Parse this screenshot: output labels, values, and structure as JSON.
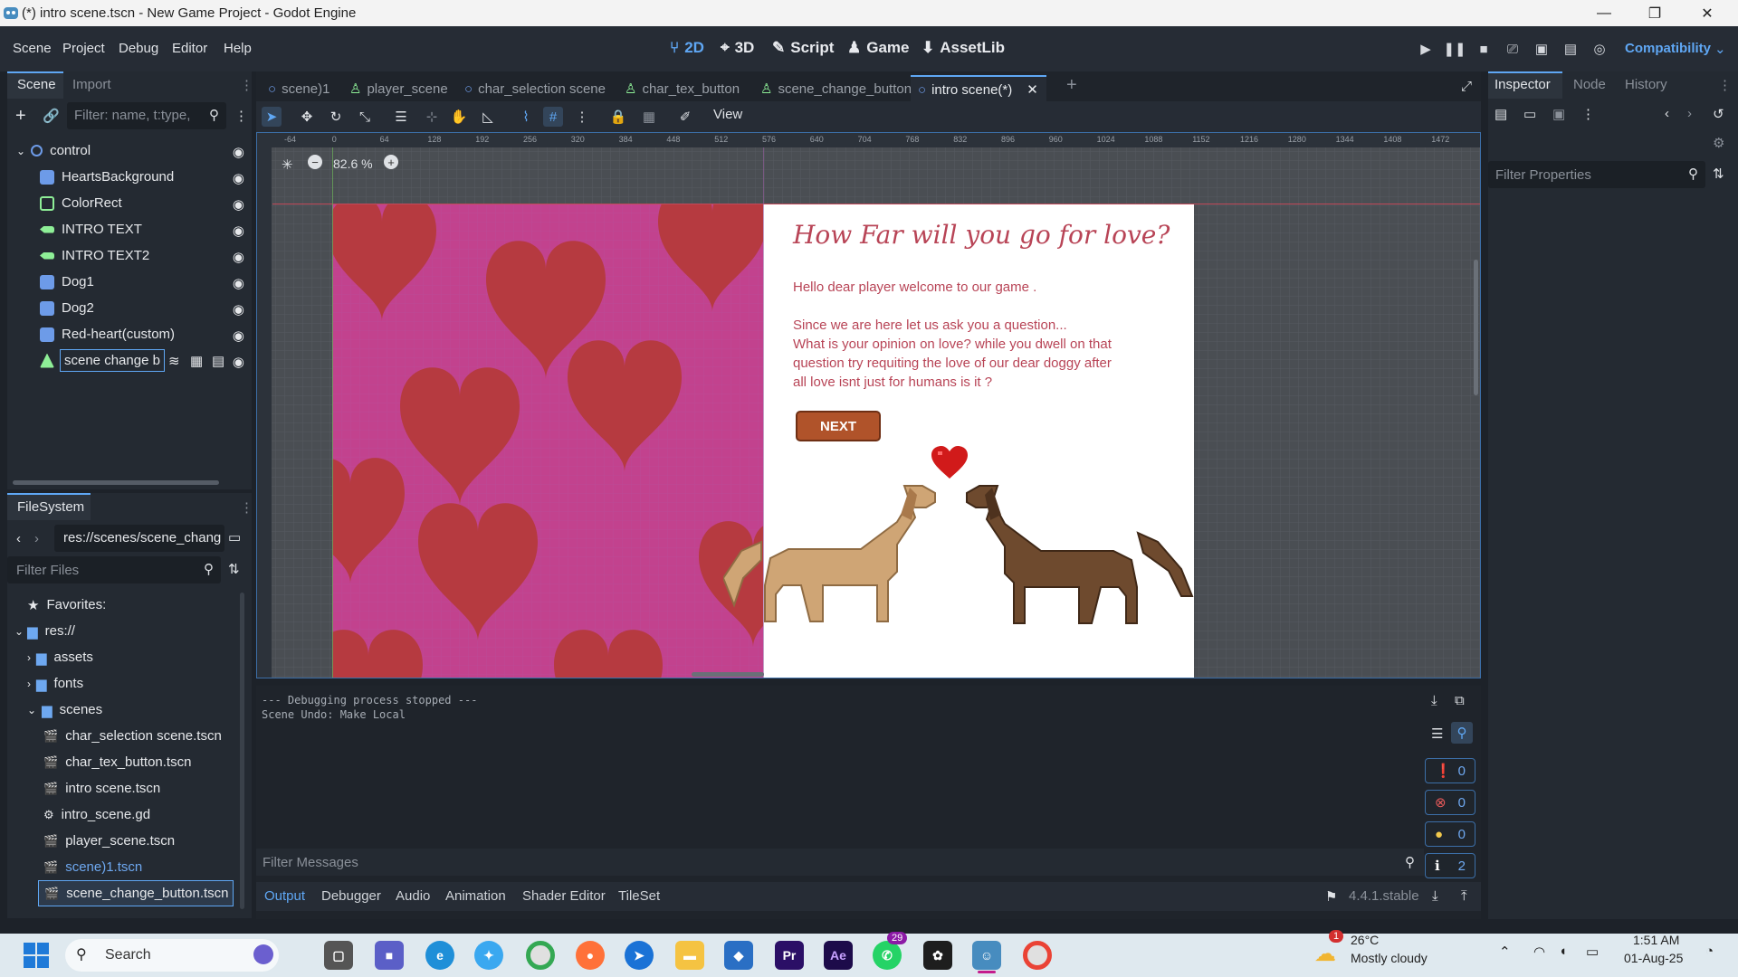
{
  "window": {
    "title": "(*) intro scene.tscn - New Game Project - Godot Engine",
    "minimize": "—",
    "maximize": "❐",
    "close": "✕"
  },
  "menu": {
    "items": [
      "Scene",
      "Project",
      "Debug",
      "Editor",
      "Help"
    ]
  },
  "main_screens": {
    "b2d": "2D",
    "b3d": "3D",
    "script": "Script",
    "game": "Game",
    "assetlib": "AssetLib"
  },
  "renderer": "Compatibility",
  "scene_dock": {
    "tabs": [
      "Scene",
      "Import"
    ],
    "filter_placeholder": "Filter: name, t:type,",
    "nodes": [
      {
        "label": "control",
        "icon": "control-icon",
        "color": "#8eef97"
      },
      {
        "label": "HeartsBackground",
        "icon": "texture-rect-icon",
        "color": "#6d9be8"
      },
      {
        "label": "ColorRect",
        "icon": "color-rect-icon",
        "color": "#8eef97"
      },
      {
        "label": "INTRO TEXT",
        "icon": "label-icon",
        "color": "#8eef97"
      },
      {
        "label": "INTRO TEXT2",
        "icon": "label-icon",
        "color": "#8eef97"
      },
      {
        "label": "Dog1",
        "icon": "texture-rect-icon",
        "color": "#6d9be8"
      },
      {
        "label": "Dog2",
        "icon": "texture-rect-icon",
        "color": "#6d9be8"
      },
      {
        "label": "Red-heart(custom)",
        "icon": "texture-rect-icon",
        "color": "#6d9be8"
      },
      {
        "label": "scene change b",
        "icon": "button-icon",
        "color": "#8eef97"
      }
    ]
  },
  "filesystem": {
    "title": "FileSystem",
    "path": "res://scenes/scene_chang",
    "filter_placeholder": "Filter Files",
    "favorites": "Favorites:",
    "root": "res://",
    "folders": [
      "assets",
      "fonts",
      "scenes"
    ],
    "files": [
      "char_selection scene.tscn",
      "char_tex_button.tscn",
      "intro scene.tscn",
      "intro_scene.gd",
      "player_scene.tscn",
      "scene)1.tscn",
      "scene_change_button.tscn"
    ]
  },
  "editor_tabs": [
    "scene)1",
    "player_scene",
    "char_selection scene",
    "char_tex_button",
    "scene_change_button",
    "intro scene(*)"
  ],
  "toolbar": {
    "view": "View"
  },
  "zoom": "82.6 %",
  "ruler_labels": [
    "-64",
    "0",
    "64",
    "128",
    "192",
    "256",
    "320",
    "384",
    "448",
    "512",
    "576",
    "640",
    "704",
    "768",
    "832",
    "896",
    "960",
    "1024",
    "1088",
    "1152",
    "1216",
    "1280",
    "1344",
    "1408",
    "1472"
  ],
  "game_scene": {
    "heading": "How Far will you go for love?",
    "line1": "Hello dear player welcome to our game .",
    "line2": "Since we are here let us ask you a question...",
    "line3": "What is your opinion on love? while you dwell on that",
    "line4": "question try requiting the love of our dear doggy after",
    "line5": "all love isnt just for humans is it ?",
    "next_button": "NEXT"
  },
  "output": {
    "lines": [
      "--- Debugging process stopped ---",
      "Scene Undo: Make Local"
    ],
    "filter_placeholder": "Filter Messages",
    "counts": {
      "errors_total": "0",
      "errors": "0",
      "warnings": "0",
      "info": "2"
    }
  },
  "bottom_tabs": [
    "Output",
    "Debugger",
    "Audio",
    "Animation",
    "Shader Editor",
    "TileSet"
  ],
  "version": "4.4.1.stable",
  "inspector": {
    "tabs": [
      "Inspector",
      "Node",
      "History"
    ],
    "filter_placeholder": "Filter Properties"
  },
  "taskbar": {
    "search": "Search",
    "weather_temp": "26°C",
    "weather_desc": "Mostly cloudy",
    "weather_badge": "1",
    "time": "1:51 AM",
    "date": "01-Aug-25",
    "whatsapp_badge": "29"
  }
}
